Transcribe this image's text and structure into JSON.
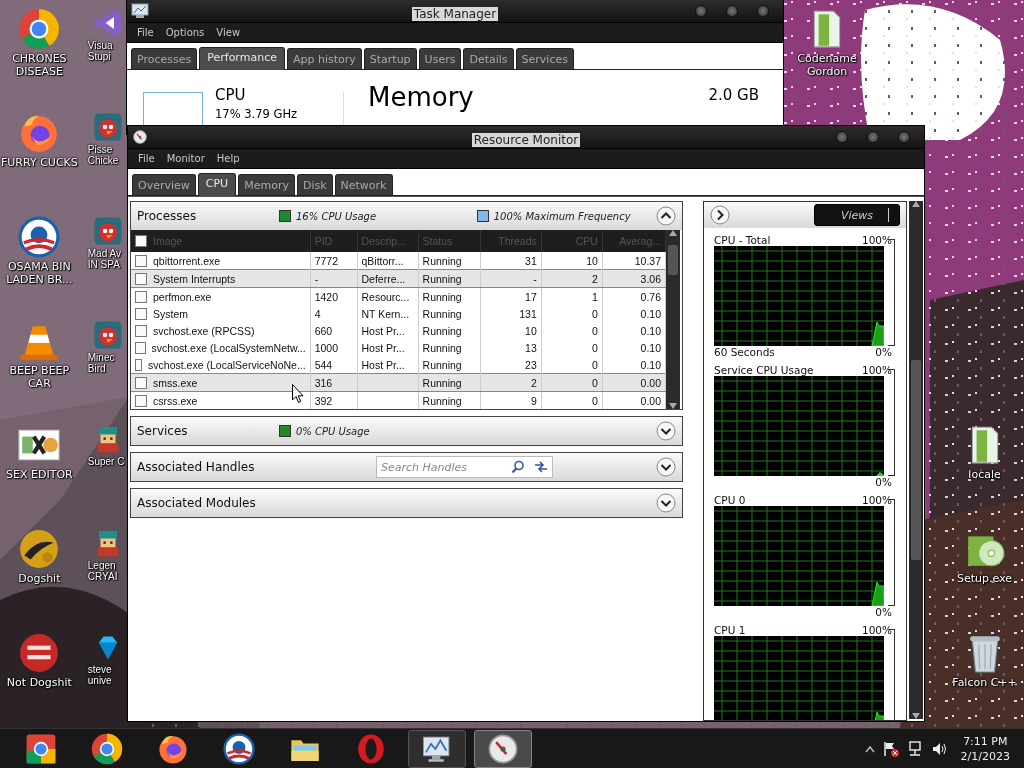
{
  "desktop": {
    "icons_column_1": [
      {
        "lines": [
          "CHRONES",
          "DISEASE"
        ],
        "kind": "ring"
      },
      {
        "lines": [
          "FURRY CUCKS"
        ],
        "kind": "fox"
      },
      {
        "lines": [
          "OSAMA BIN",
          "LADEN BR..."
        ],
        "kind": "stripes"
      },
      {
        "lines": [
          "BEEP BEEP",
          "CAR"
        ],
        "kind": "cone"
      },
      {
        "lines": [
          "SEX EDITOR"
        ],
        "kind": "tile"
      },
      {
        "lines": [
          "Dogshit"
        ],
        "kind": "gold"
      },
      {
        "lines": [
          "Not Dogshit"
        ],
        "kind": "redcircle"
      }
    ],
    "icons_column_2": [
      {
        "lines": [
          "Visua",
          "Stupi"
        ],
        "kind": "purple"
      },
      {
        "lines": [
          "Pisse",
          "Chicke"
        ],
        "kind": "bird"
      },
      {
        "lines": [
          "Mad Av",
          "IN SPA"
        ],
        "kind": "bird"
      },
      {
        "lines": [
          "Minec",
          "Bird"
        ],
        "kind": "bird"
      },
      {
        "lines": [
          "Super C"
        ],
        "kind": "pixel"
      },
      {
        "lines": [
          "Legen",
          "CRYAI"
        ],
        "kind": "pixel"
      },
      {
        "lines": [
          "steve",
          "unive"
        ],
        "kind": "gem"
      }
    ],
    "icons_top_right": [
      {
        "lines": [
          "Codename",
          "Gordon"
        ],
        "kind": "file"
      }
    ],
    "icons_right": [
      {
        "lines": [
          "locale"
        ],
        "kind": "file"
      },
      {
        "lines": [
          "Setup.exe"
        ],
        "kind": "disc"
      },
      {
        "lines": [
          "Falcon C++"
        ],
        "kind": "bin"
      }
    ]
  },
  "task_manager": {
    "title": "Task Manager",
    "menu": [
      "File",
      "Options",
      "View"
    ],
    "tabs": [
      {
        "label": "Processes",
        "selected": false
      },
      {
        "label": "Performance",
        "selected": true
      },
      {
        "label": "App history",
        "selected": false
      },
      {
        "label": "Startup",
        "selected": false
      },
      {
        "label": "Users",
        "selected": false
      },
      {
        "label": "Details",
        "selected": false
      },
      {
        "label": "Services",
        "selected": false
      }
    ],
    "cpu_label": "CPU",
    "cpu_reading": "17% 3.79 GHz",
    "heading": "Memory",
    "memory_total": "2.0 GB"
  },
  "resource_monitor": {
    "title": "Resource Monitor",
    "menu": [
      "File",
      "Monitor",
      "Help"
    ],
    "tabs": [
      {
        "label": "Overview",
        "selected": false
      },
      {
        "label": "CPU",
        "selected": true
      },
      {
        "label": "Memory",
        "selected": false
      },
      {
        "label": "Disk",
        "selected": false
      },
      {
        "label": "Network",
        "selected": false
      }
    ],
    "processes": {
      "title": "Processes",
      "legend": [
        {
          "text": "16% CPU Usage",
          "color": "#1f8a2c"
        },
        {
          "text": "100% Maximum Frequency",
          "color": "#7fb8ea"
        }
      ],
      "expanded": true,
      "header_checked": false,
      "columns": [
        "Image",
        "PID",
        "Descrip...",
        "Status",
        "Threads",
        "CPU",
        "Averag..."
      ],
      "rows": [
        {
          "cells": [
            "qbittorrent.exe",
            "7772",
            "qBittorr...",
            "Running",
            "31",
            "10",
            "10.37"
          ],
          "checked": false,
          "selected": false
        },
        {
          "cells": [
            "System Interrupts",
            "-",
            "Deferre...",
            "Running",
            "-",
            "2",
            "3.06"
          ],
          "checked": false,
          "selected": true
        },
        {
          "cells": [
            "perfmon.exe",
            "1420",
            "Resourc...",
            "Running",
            "17",
            "1",
            "0.76"
          ],
          "checked": false,
          "selected": false
        },
        {
          "cells": [
            "System",
            "4",
            "NT Kern...",
            "Running",
            "131",
            "0",
            "0.10"
          ],
          "checked": false,
          "selected": false
        },
        {
          "cells": [
            "svchost.exe (RPCSS)",
            "660",
            "Host Pr...",
            "Running",
            "10",
            "0",
            "0.10"
          ],
          "checked": false,
          "selected": false
        },
        {
          "cells": [
            "svchost.exe (LocalSystemNetw...",
            "1000",
            "Host Pr...",
            "Running",
            "13",
            "0",
            "0.10"
          ],
          "checked": false,
          "selected": false
        },
        {
          "cells": [
            "svchost.exe (LocalServiceNoNe...",
            "544",
            "Host Pr...",
            "Running",
            "23",
            "0",
            "0.10"
          ],
          "checked": false,
          "selected": false
        },
        {
          "cells": [
            "smss.exe",
            "316",
            "",
            "Running",
            "2",
            "0",
            "0.00"
          ],
          "checked": false,
          "selected": true
        },
        {
          "cells": [
            "csrss.exe",
            "392",
            "",
            "Running",
            "9",
            "0",
            "0.00"
          ],
          "checked": false,
          "selected": false
        }
      ]
    },
    "sections": [
      {
        "title": "Services",
        "kind": "legend",
        "legend_text": "0% CPU Usage",
        "color": "#1f8a2c",
        "expanded": false
      },
      {
        "title": "Associated Handles",
        "kind": "search",
        "placeholder": "Search Handles",
        "expanded": false
      },
      {
        "title": "Associated Modules",
        "kind": "plain",
        "expanded": false
      }
    ],
    "views_button": "Views",
    "graphs": [
      {
        "title": "CPU - Total",
        "max": "100%",
        "footer": "60 Seconds",
        "min": "0%"
      },
      {
        "title": "Service CPU Usage",
        "max": "100%",
        "min": "0%"
      },
      {
        "title": "CPU 0",
        "max": "100%",
        "min": "0%"
      },
      {
        "title": "CPU 1",
        "max": "100%"
      }
    ]
  },
  "taskbar": {
    "apps": [
      {
        "kind": "ring2",
        "running": false,
        "selected": false
      },
      {
        "kind": "ring",
        "running": false,
        "selected": false
      },
      {
        "kind": "fox",
        "running": false,
        "selected": false
      },
      {
        "kind": "stripes",
        "running": false,
        "selected": false
      },
      {
        "kind": "folder",
        "running": false,
        "selected": false
      },
      {
        "kind": "redring",
        "running": false,
        "selected": false
      },
      {
        "kind": "monitor",
        "running": true,
        "selected": false
      },
      {
        "kind": "gauge",
        "running": true,
        "selected": true
      }
    ],
    "time": "7:11 PM",
    "date": "2/1/2023"
  }
}
